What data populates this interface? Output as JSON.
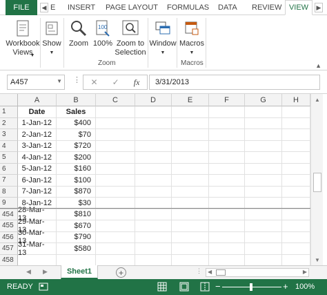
{
  "ribbon_tabs": {
    "file": "FILE",
    "items": [
      {
        "label": "E"
      },
      {
        "label": "INSERT"
      },
      {
        "label": "PAGE LAYOUT"
      },
      {
        "label": "FORMULAS"
      },
      {
        "label": "DATA"
      },
      {
        "label": "REVIEW"
      },
      {
        "label": "VIEW"
      }
    ]
  },
  "ribbon": {
    "workbook_views": "Workbook\nViews",
    "show": "Show",
    "zoom": "Zoom",
    "zoom100": "100%",
    "zoom_selection": "Zoom to\nSelection",
    "window": "Window",
    "macros": "Macros",
    "group_zoom": "Zoom",
    "group_macros": "Macros"
  },
  "formula_bar": {
    "name_box": "A457",
    "cancel": "✕",
    "enter": "✓",
    "fx": "fx",
    "value": "3/31/2013"
  },
  "grid": {
    "columns": [
      "A",
      "B",
      "C",
      "D",
      "E",
      "F",
      "G",
      "H"
    ],
    "rows": [
      {
        "n": "1",
        "a": "Date",
        "b": "Sales",
        "header": true
      },
      {
        "n": "2",
        "a": "1-Jan-12",
        "b": "$400"
      },
      {
        "n": "3",
        "a": "2-Jan-12",
        "b": "$70"
      },
      {
        "n": "4",
        "a": "3-Jan-12",
        "b": "$720"
      },
      {
        "n": "5",
        "a": "4-Jan-12",
        "b": "$200"
      },
      {
        "n": "6",
        "a": "5-Jan-12",
        "b": "$160"
      },
      {
        "n": "7",
        "a": "6-Jan-12",
        "b": "$100"
      },
      {
        "n": "8",
        "a": "7-Jan-12",
        "b": "$870"
      },
      {
        "n": "9",
        "a": "8-Jan-12",
        "b": "$30"
      },
      {
        "n": "454",
        "a": "28-Mar-13",
        "b": "$810"
      },
      {
        "n": "455",
        "a": "29-Mar-13",
        "b": "$670"
      },
      {
        "n": "456",
        "a": "30-Mar-13",
        "b": "$790"
      },
      {
        "n": "457",
        "a": "31-Mar-13",
        "b": "$580"
      },
      {
        "n": "458",
        "a": "",
        "b": ""
      }
    ]
  },
  "sheets": {
    "active": "Sheet1",
    "add": "+"
  },
  "status": {
    "ready": "READY",
    "zoom_percent": "100%",
    "zoom_minus": "−",
    "zoom_plus": "+"
  },
  "colors": {
    "excel_green": "#217346"
  }
}
